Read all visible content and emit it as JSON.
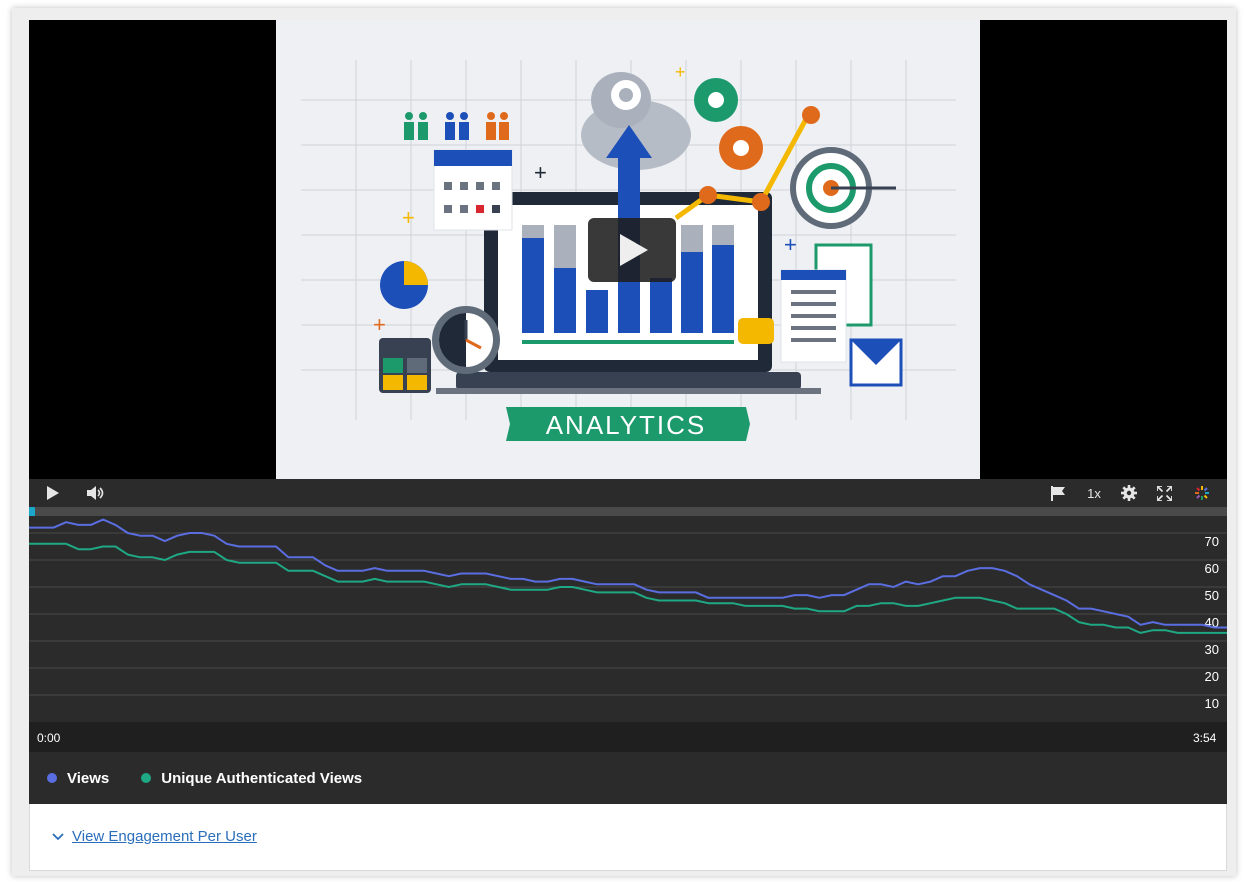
{
  "player": {
    "thumbnail_banner": "ANALYTICS",
    "controls": {
      "play_icon": "play-icon",
      "volume_icon": "volume-icon",
      "flag_icon": "flag-icon",
      "speed_label": "1x",
      "settings_icon": "gear-icon",
      "fullscreen_icon": "fullscreen-icon",
      "logo_icon": "kaltura-logo-icon"
    },
    "playback_position": 0,
    "accent_color": "#1aa7c9"
  },
  "chart_data": {
    "type": "line",
    "x_start_label": "0:00",
    "x_end_label": "3:54",
    "ylim": [
      0,
      80
    ],
    "yticks": [
      10,
      20,
      30,
      40,
      50,
      60,
      70
    ],
    "grid": true,
    "legend_position": "bottom-left",
    "series": [
      {
        "name": "Views",
        "color": "#5b6ee1",
        "values": [
          72,
          72,
          72,
          74,
          73,
          73,
          75,
          73,
          70,
          69,
          69,
          67,
          69,
          70,
          70,
          69,
          66,
          65,
          65,
          65,
          65,
          61,
          61,
          61,
          58,
          56,
          56,
          56,
          57,
          56,
          56,
          56,
          56,
          55,
          54,
          55,
          55,
          55,
          54,
          53,
          53,
          52,
          52,
          53,
          53,
          52,
          51,
          51,
          51,
          51,
          49,
          48,
          48,
          48,
          48,
          46,
          46,
          46,
          46,
          46,
          46,
          46,
          47,
          47,
          46,
          47,
          47,
          49,
          51,
          51,
          50,
          52,
          51,
          52,
          54,
          54,
          56,
          57,
          57,
          56,
          54,
          51,
          49,
          47,
          45,
          42,
          42,
          41,
          40,
          39,
          36,
          37,
          36,
          36,
          36,
          36,
          35,
          35
        ]
      },
      {
        "name": "Unique Authenticated Views",
        "color": "#1fa884",
        "values": [
          66,
          66,
          66,
          66,
          64,
          64,
          65,
          65,
          62,
          61,
          61,
          60,
          62,
          63,
          63,
          63,
          60,
          59,
          59,
          59,
          59,
          56,
          56,
          56,
          54,
          52,
          52,
          52,
          53,
          52,
          52,
          52,
          52,
          51,
          50,
          51,
          51,
          51,
          50,
          49,
          49,
          49,
          49,
          50,
          50,
          49,
          48,
          48,
          48,
          48,
          46,
          45,
          45,
          45,
          45,
          44,
          44,
          44,
          43,
          43,
          43,
          43,
          42,
          42,
          41,
          41,
          41,
          43,
          43,
          44,
          44,
          43,
          43,
          44,
          45,
          46,
          46,
          46,
          45,
          44,
          42,
          42,
          42,
          42,
          40,
          37,
          36,
          36,
          35,
          35,
          33,
          34,
          34,
          33,
          33,
          33,
          33,
          33
        ]
      }
    ]
  },
  "link": {
    "label": "View Engagement Per User",
    "chevron_icon": "chevron-down-icon"
  }
}
